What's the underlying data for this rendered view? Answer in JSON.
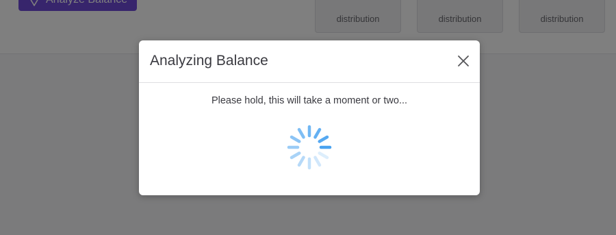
{
  "background": {
    "analyze_button": {
      "label": "Analyze Balance",
      "color": "#6f4bd8",
      "icon": "pin-icon"
    },
    "distribution_cards": [
      {
        "label": "distribution"
      },
      {
        "label": "distribution"
      },
      {
        "label": "distribution"
      }
    ]
  },
  "overlay": {
    "color": "rgba(0,0,0,0.5)"
  },
  "modal": {
    "title": "Analyzing Balance",
    "message": "Please hold, this will take a moment or two...",
    "close_icon": "close-icon",
    "spinner": {
      "icon": "loading-spinner-icon",
      "color": "#4aa3f0"
    }
  }
}
